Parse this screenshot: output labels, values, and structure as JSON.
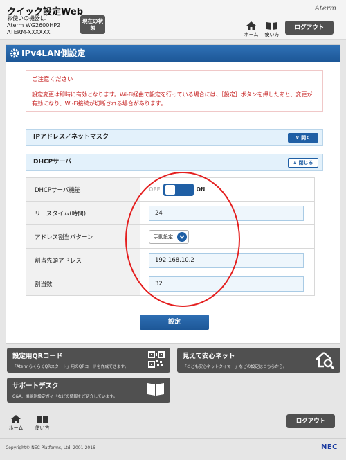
{
  "header": {
    "app_title": "クイック設定Web",
    "device_label": "お使いの機器は",
    "device_model": "Aterm WG2600HP2",
    "device_name": "ATERM-XXXXXX",
    "status_button": "現在の状態",
    "brand": "Aterm",
    "home_label": "ホーム",
    "guide_label": "使い方",
    "logout_label": "ログアウト"
  },
  "main": {
    "section_title": "IPv4LAN側設定",
    "notice_title": "ご注意ください",
    "notice_body": "設定変更は即時に有効となります。Wi-Fi経由で設定を行っている場合には、［設定］ボタンを押したあと、変更が有効になり、Wi-Fi接続が切断される場合があります。",
    "ip_section": {
      "label": "IPアドレス／ネットマスク",
      "button": "開く"
    },
    "dhcp_section": {
      "label": "DHCPサーバ",
      "button": "閉じる"
    },
    "fields": {
      "dhcp_function": {
        "label": "DHCPサーバ機能",
        "off_label": "OFF",
        "on_label": "ON",
        "state": "ON"
      },
      "lease_time": {
        "label": "リースタイム(時間)",
        "value": "24"
      },
      "assign_pattern": {
        "label": "アドレス割当パターン",
        "value": "手動設定"
      },
      "start_address": {
        "label": "割当先頭アドレス",
        "value": "192.168.10.2"
      },
      "assign_count": {
        "label": "割当数",
        "value": "32"
      }
    },
    "submit_label": "設定"
  },
  "cards": {
    "qr": {
      "title": "設定用QRコード",
      "desc": "「AtermらくらくQRスタート」用のQRコードを作成できます。"
    },
    "safety": {
      "title": "見えて安心ネット",
      "desc": "「こども安心ネットタイマー」などの設定はこちらから。"
    },
    "support": {
      "title": "サポートデスク",
      "desc": "Q&A、機能別設定ガイドなどの情報をご紹介しています。"
    }
  },
  "footer": {
    "home_label": "ホーム",
    "guide_label": "使い方",
    "logout_label": "ログアウト",
    "copyright": "Copyright© NEC Platforms, Ltd. 2001-2016",
    "logo": "NEC"
  },
  "colors": {
    "primary_blue": "#1f5fa5",
    "notice_red": "#c62020",
    "annotation_red": "#e41f1f",
    "dark_button": "#505050"
  }
}
